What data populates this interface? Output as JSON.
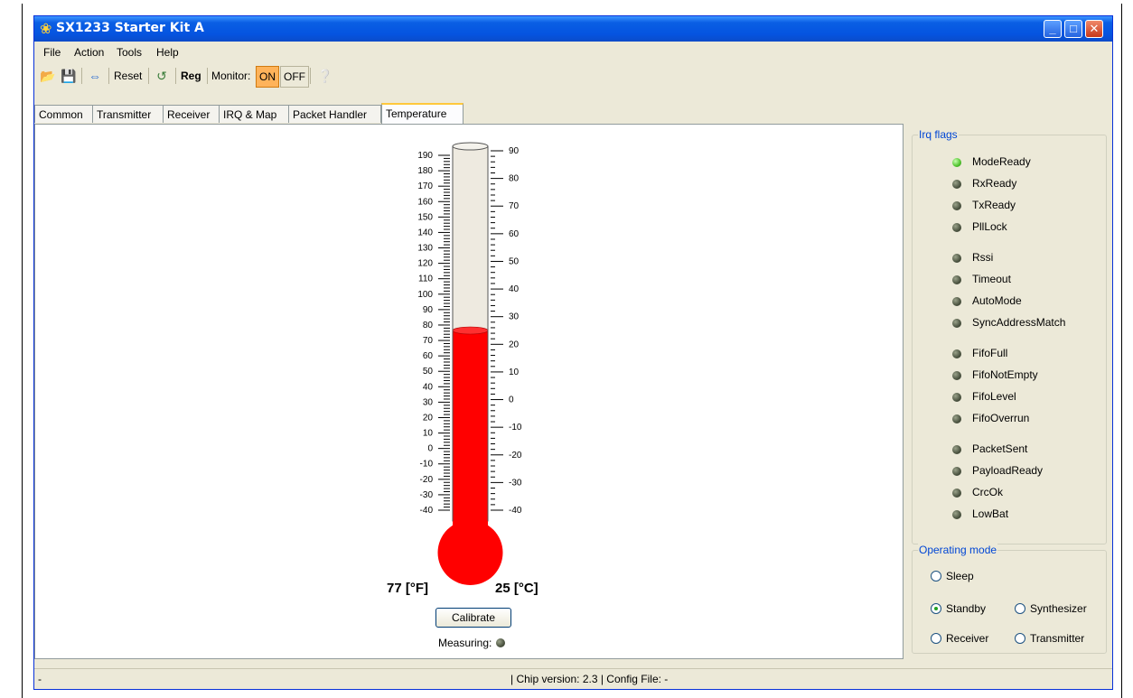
{
  "window": {
    "title": "SX1233 Starter Kit A"
  },
  "menu": [
    "File",
    "Action",
    "Tools",
    "Help"
  ],
  "toolbar": {
    "reset": "Reset",
    "reg": "Reg",
    "monitor": "Monitor:",
    "on": "ON",
    "off": "OFF"
  },
  "tabs": [
    "Common",
    "Transmitter",
    "Receiver",
    "IRQ & Map",
    "Packet Handler",
    "Temperature"
  ],
  "active_tab": "Temperature",
  "thermometer": {
    "fahrenheit_scale": [
      190,
      180,
      170,
      160,
      150,
      140,
      130,
      120,
      110,
      100,
      90,
      80,
      70,
      60,
      50,
      40,
      30,
      20,
      10,
      0,
      -10,
      -20,
      -30,
      -40
    ],
    "celsius_scale": [
      90,
      80,
      70,
      60,
      50,
      40,
      30,
      20,
      10,
      0,
      -10,
      -20,
      -30,
      -40
    ],
    "fahrenheit_reading": "77 [°F]",
    "celsius_reading": "25 [°C]",
    "temperature_c": 25,
    "fill_color": "#ff0000"
  },
  "calibrate_label": "Calibrate",
  "measuring_label": "Measuring:",
  "irq": {
    "title": "Irq flags",
    "flags": [
      {
        "label": "ModeReady",
        "active": true
      },
      {
        "label": "RxReady",
        "active": false
      },
      {
        "label": "TxReady",
        "active": false
      },
      {
        "label": "PllLock",
        "active": false
      },
      {
        "label": "Rssi",
        "active": false
      },
      {
        "label": "Timeout",
        "active": false
      },
      {
        "label": "AutoMode",
        "active": false
      },
      {
        "label": "SyncAddressMatch",
        "active": false
      },
      {
        "label": "FifoFull",
        "active": false
      },
      {
        "label": "FifoNotEmpty",
        "active": false
      },
      {
        "label": "FifoLevel",
        "active": false
      },
      {
        "label": "FifoOverrun",
        "active": false
      },
      {
        "label": "PacketSent",
        "active": false
      },
      {
        "label": "PayloadReady",
        "active": false
      },
      {
        "label": "CrcOk",
        "active": false
      },
      {
        "label": "LowBat",
        "active": false
      }
    ]
  },
  "mode": {
    "title": "Operating mode",
    "options": [
      "Sleep",
      "Standby",
      "Synthesizer",
      "Receiver",
      "Transmitter"
    ],
    "selected": "Standby"
  },
  "status": {
    "left": "-",
    "chip": "|  Chip version: 2.3  |  Config File: -"
  },
  "colors": {
    "title_bar": "#0554e0",
    "led_on": "#4ec22c",
    "led_off": "#4b5340",
    "monitor_on": "#ffb35a",
    "group_title": "#0046d5"
  }
}
